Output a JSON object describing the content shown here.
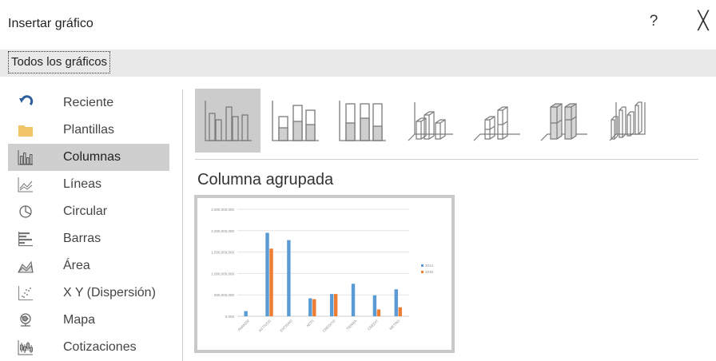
{
  "window": {
    "title": "Insertar gráfico",
    "help_label": "?",
    "close_label": "╳"
  },
  "tabs": [
    {
      "label": "Todos los gráficos"
    }
  ],
  "sidebar": {
    "items": [
      {
        "label": "Reciente",
        "icon": "recent-icon"
      },
      {
        "label": "Plantillas",
        "icon": "folder-icon"
      },
      {
        "label": "Columnas",
        "icon": "column-chart-icon",
        "selected": true
      },
      {
        "label": "Líneas",
        "icon": "line-chart-icon"
      },
      {
        "label": "Circular",
        "icon": "pie-chart-icon"
      },
      {
        "label": "Barras",
        "icon": "bar-chart-icon"
      },
      {
        "label": "Área",
        "icon": "area-chart-icon"
      },
      {
        "label": "X Y (Dispersión)",
        "icon": "scatter-chart-icon"
      },
      {
        "label": "Mapa",
        "icon": "map-chart-icon"
      },
      {
        "label": "Cotizaciones",
        "icon": "stock-chart-icon"
      }
    ]
  },
  "subtypes": [
    {
      "name": "clustered-column",
      "selected": true
    },
    {
      "name": "stacked-column"
    },
    {
      "name": "100-stacked-column"
    },
    {
      "name": "3d-clustered-column"
    },
    {
      "name": "3d-stacked-column"
    },
    {
      "name": "3d-100-stacked-column"
    },
    {
      "name": "3d-column"
    }
  ],
  "selected_chart_name": "Columna agrupada",
  "colors": {
    "series_blue": "#5b9bd5",
    "series_orange": "#ed7d31",
    "selected_bg": "#cccccc",
    "tabstrip_bg": "#e9e9e9"
  },
  "chart_data": {
    "type": "bar",
    "y_tick_labels": [
      "0.000",
      "500,000,000",
      "1,000,000,000",
      "1,500,000,000",
      "2,000,000,000",
      "2,500,000,000"
    ],
    "ylim": [
      0,
      2500000000
    ],
    "grid": true,
    "legend_position": "right",
    "categories": [
      "PARKER",
      "ACTIVOS",
      "ENTIDAD",
      "NOTI",
      "CREDITO",
      "TIERRA",
      "CREDIT",
      "METRO"
    ],
    "series": [
      {
        "name": "2014",
        "color": "#5b9bd5",
        "values": [
          120000000,
          1950000000,
          1780000000,
          420000000,
          520000000,
          760000000,
          490000000,
          630000000
        ]
      },
      {
        "name": "2016",
        "color": "#ed7d31",
        "values": [
          0,
          1580000000,
          0,
          400000000,
          520000000,
          0,
          160000000,
          210000000
        ]
      }
    ]
  }
}
